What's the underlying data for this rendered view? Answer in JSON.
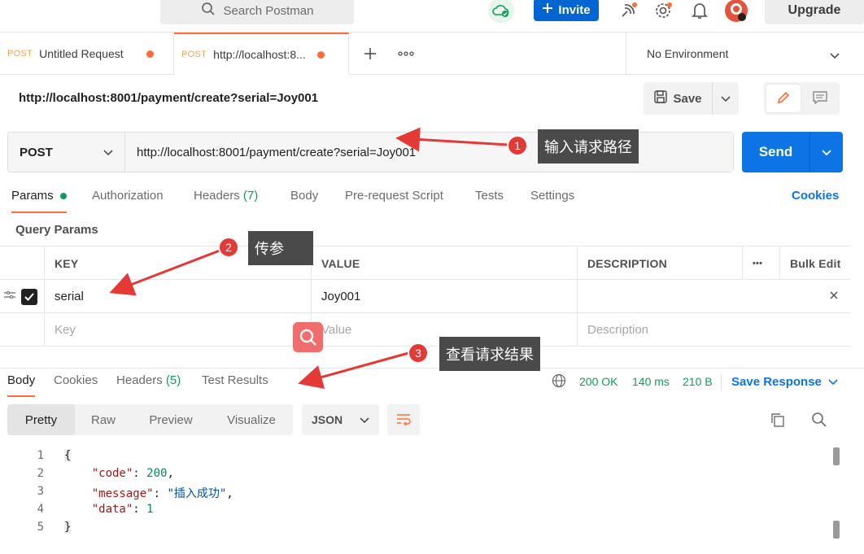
{
  "topbar": {
    "search_placeholder": "Search Postman",
    "invite_label": "Invite",
    "upgrade_label": "Upgrade"
  },
  "tabs": [
    {
      "method": "POST",
      "title": "Untitled Request"
    },
    {
      "method": "POST",
      "title": "http://localhost:8..."
    }
  ],
  "environment": "No Environment",
  "request": {
    "title": "http://localhost:8001/payment/create?serial=Joy001",
    "save_label": "Save",
    "method": "POST",
    "url": "http://localhost:8001/payment/create?serial=Joy001",
    "send_label": "Send"
  },
  "request_tabs": {
    "params": "Params",
    "authorization": "Authorization",
    "headers": "Headers",
    "headers_count": "(7)",
    "body": "Body",
    "prerequest": "Pre-request Script",
    "tests": "Tests",
    "settings": "Settings",
    "cookies": "Cookies"
  },
  "query_params": {
    "title": "Query Params",
    "col_key": "KEY",
    "col_value": "VALUE",
    "col_description": "DESCRIPTION",
    "more": "•••",
    "bulk_edit": "Bulk Edit",
    "rows": [
      {
        "key": "serial",
        "value": "Joy001",
        "checked": true
      }
    ],
    "placeholder_key": "Key",
    "placeholder_value": "Value",
    "placeholder_description": "Description"
  },
  "response": {
    "tabs": {
      "body": "Body",
      "cookies": "Cookies",
      "headers": "Headers",
      "headers_count": "(5)",
      "test_results": "Test Results"
    },
    "status": "200 OK",
    "time": "140 ms",
    "size": "210 B",
    "save_response": "Save Response",
    "views": [
      "Pretty",
      "Raw",
      "Preview",
      "Visualize"
    ],
    "format": "JSON",
    "code_lines": [
      {
        "num": "1"
      },
      {
        "num": "2",
        "key": "\"code\"",
        "value": "200",
        "type": "number",
        "comma": ","
      },
      {
        "num": "3",
        "key": "\"message\"",
        "value": "\"插入成功\"",
        "type": "string",
        "comma": ","
      },
      {
        "num": "4",
        "key": "\"data\"",
        "value": "1",
        "type": "number",
        "comma": ""
      },
      {
        "num": "5"
      }
    ],
    "open_brace": "{",
    "close_brace": "}"
  },
  "annotations": [
    {
      "num": "1",
      "text": "输入请求路径"
    },
    {
      "num": "2",
      "text": "传参"
    },
    {
      "num": "3",
      "text": "查看请求结果"
    }
  ],
  "colors": {
    "accent": "#ff6c37",
    "primary": "#0c74e4",
    "success": "#0f9d58",
    "annotation_red": "#e53935"
  }
}
